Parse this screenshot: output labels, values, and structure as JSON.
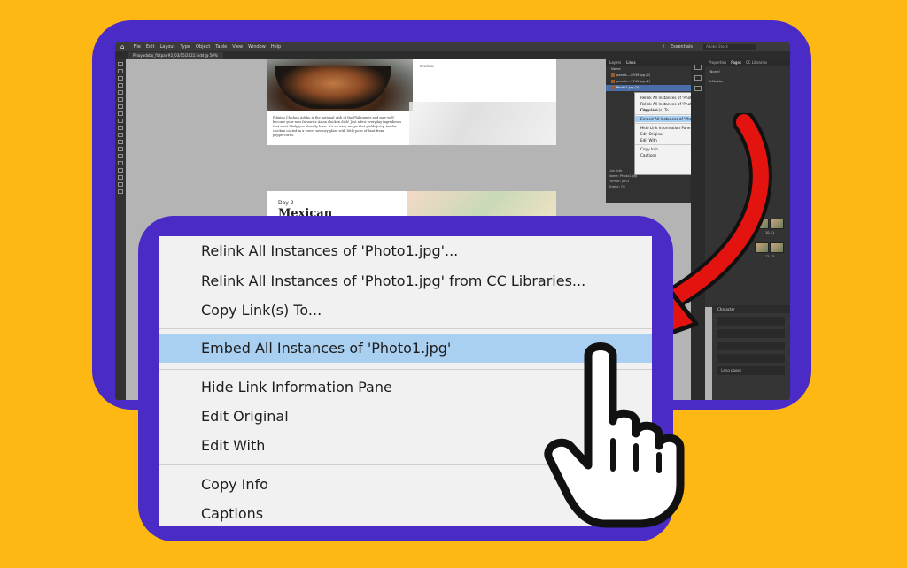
{
  "app": {
    "menu": [
      "File",
      "Edit",
      "Layout",
      "Type",
      "Object",
      "Table",
      "View",
      "Window",
      "Help"
    ],
    "workspace_label": "Essentials",
    "search_placeholder": "Adobe Stock",
    "document_tab": "Pinoyadobo_flatpan#2_03/15/2022.indd @ 50%"
  },
  "page_mock": {
    "spread1_caption": "Pilipino Chicken Adobo is the national dish of the Philippines and may well become your new favourite Asian chicken dish! Just a few everyday ingredients that most likely you already have. It's an easy recipe that yields juicy, tender chicken coated in a sweet savoury glaze with little pops of heat from peppercorns.",
    "spread1_directions": "Directions",
    "spread2_day": "Day 2",
    "spread2_title": "Mexican"
  },
  "links_panel": {
    "tabs": [
      "Layers",
      "Links"
    ],
    "active_tab": "Links",
    "name_header": "Name",
    "rows": [
      "pexels-...8939.jpg (2)",
      "pexels-...9745.jpg (2)",
      "Photo1.jpg (2)"
    ],
    "info_title": "Link Info",
    "info_name_label": "Name:",
    "info_name_value": "Photo1.jpg",
    "info_format_label": "Format:",
    "info_format_value": "JPEG",
    "info_status_label": "Status:",
    "info_status_value": "OK"
  },
  "small_context_menu": {
    "items": [
      "Relink All Instances of 'Photo1.jpg'...",
      "Relink All Instances of 'Photo1.jpg' from CC Libraries...",
      "Copy Link(s) To...",
      "Embed All Instances of 'Photo1.jpg'",
      "Hide Link Information Pane",
      "Edit Original",
      "Edit With",
      "Copy Info",
      "Captions"
    ],
    "highlighted_index": 3
  },
  "pages_panel": {
    "tabs": [
      "Properties",
      "Pages",
      "CC Libraries"
    ],
    "active_tab": "Pages",
    "none_label": "[None]",
    "master_label": "A-Master",
    "spread_labels": [
      "10-11",
      "12-13"
    ]
  },
  "character_panel": {
    "title": "Character",
    "lang_label": "Lang pages"
  },
  "context_menu": {
    "items": [
      {
        "label": "Relink All Instances of 'Photo1.jpg'..."
      },
      {
        "label": "Relink All Instances of 'Photo1.jpg' from CC Libraries..."
      },
      {
        "label": "Copy Link(s) To..."
      },
      {
        "label": "Embed All Instances of 'Photo1.jpg'",
        "highlighted": true
      },
      {
        "label": "Hide Link Information Pane"
      },
      {
        "label": "Edit Original"
      },
      {
        "label": "Edit With"
      },
      {
        "label": "Copy Info"
      },
      {
        "label": "Captions"
      }
    ]
  },
  "colors": {
    "background": "#FDB813",
    "frame": "#4A2BC6",
    "highlight": "#A9CFF1",
    "arrow": "#E3130F"
  },
  "icons": [
    "home-icon",
    "share-icon",
    "search-icon",
    "hand-pointer-icon",
    "curved-arrow-icon"
  ]
}
